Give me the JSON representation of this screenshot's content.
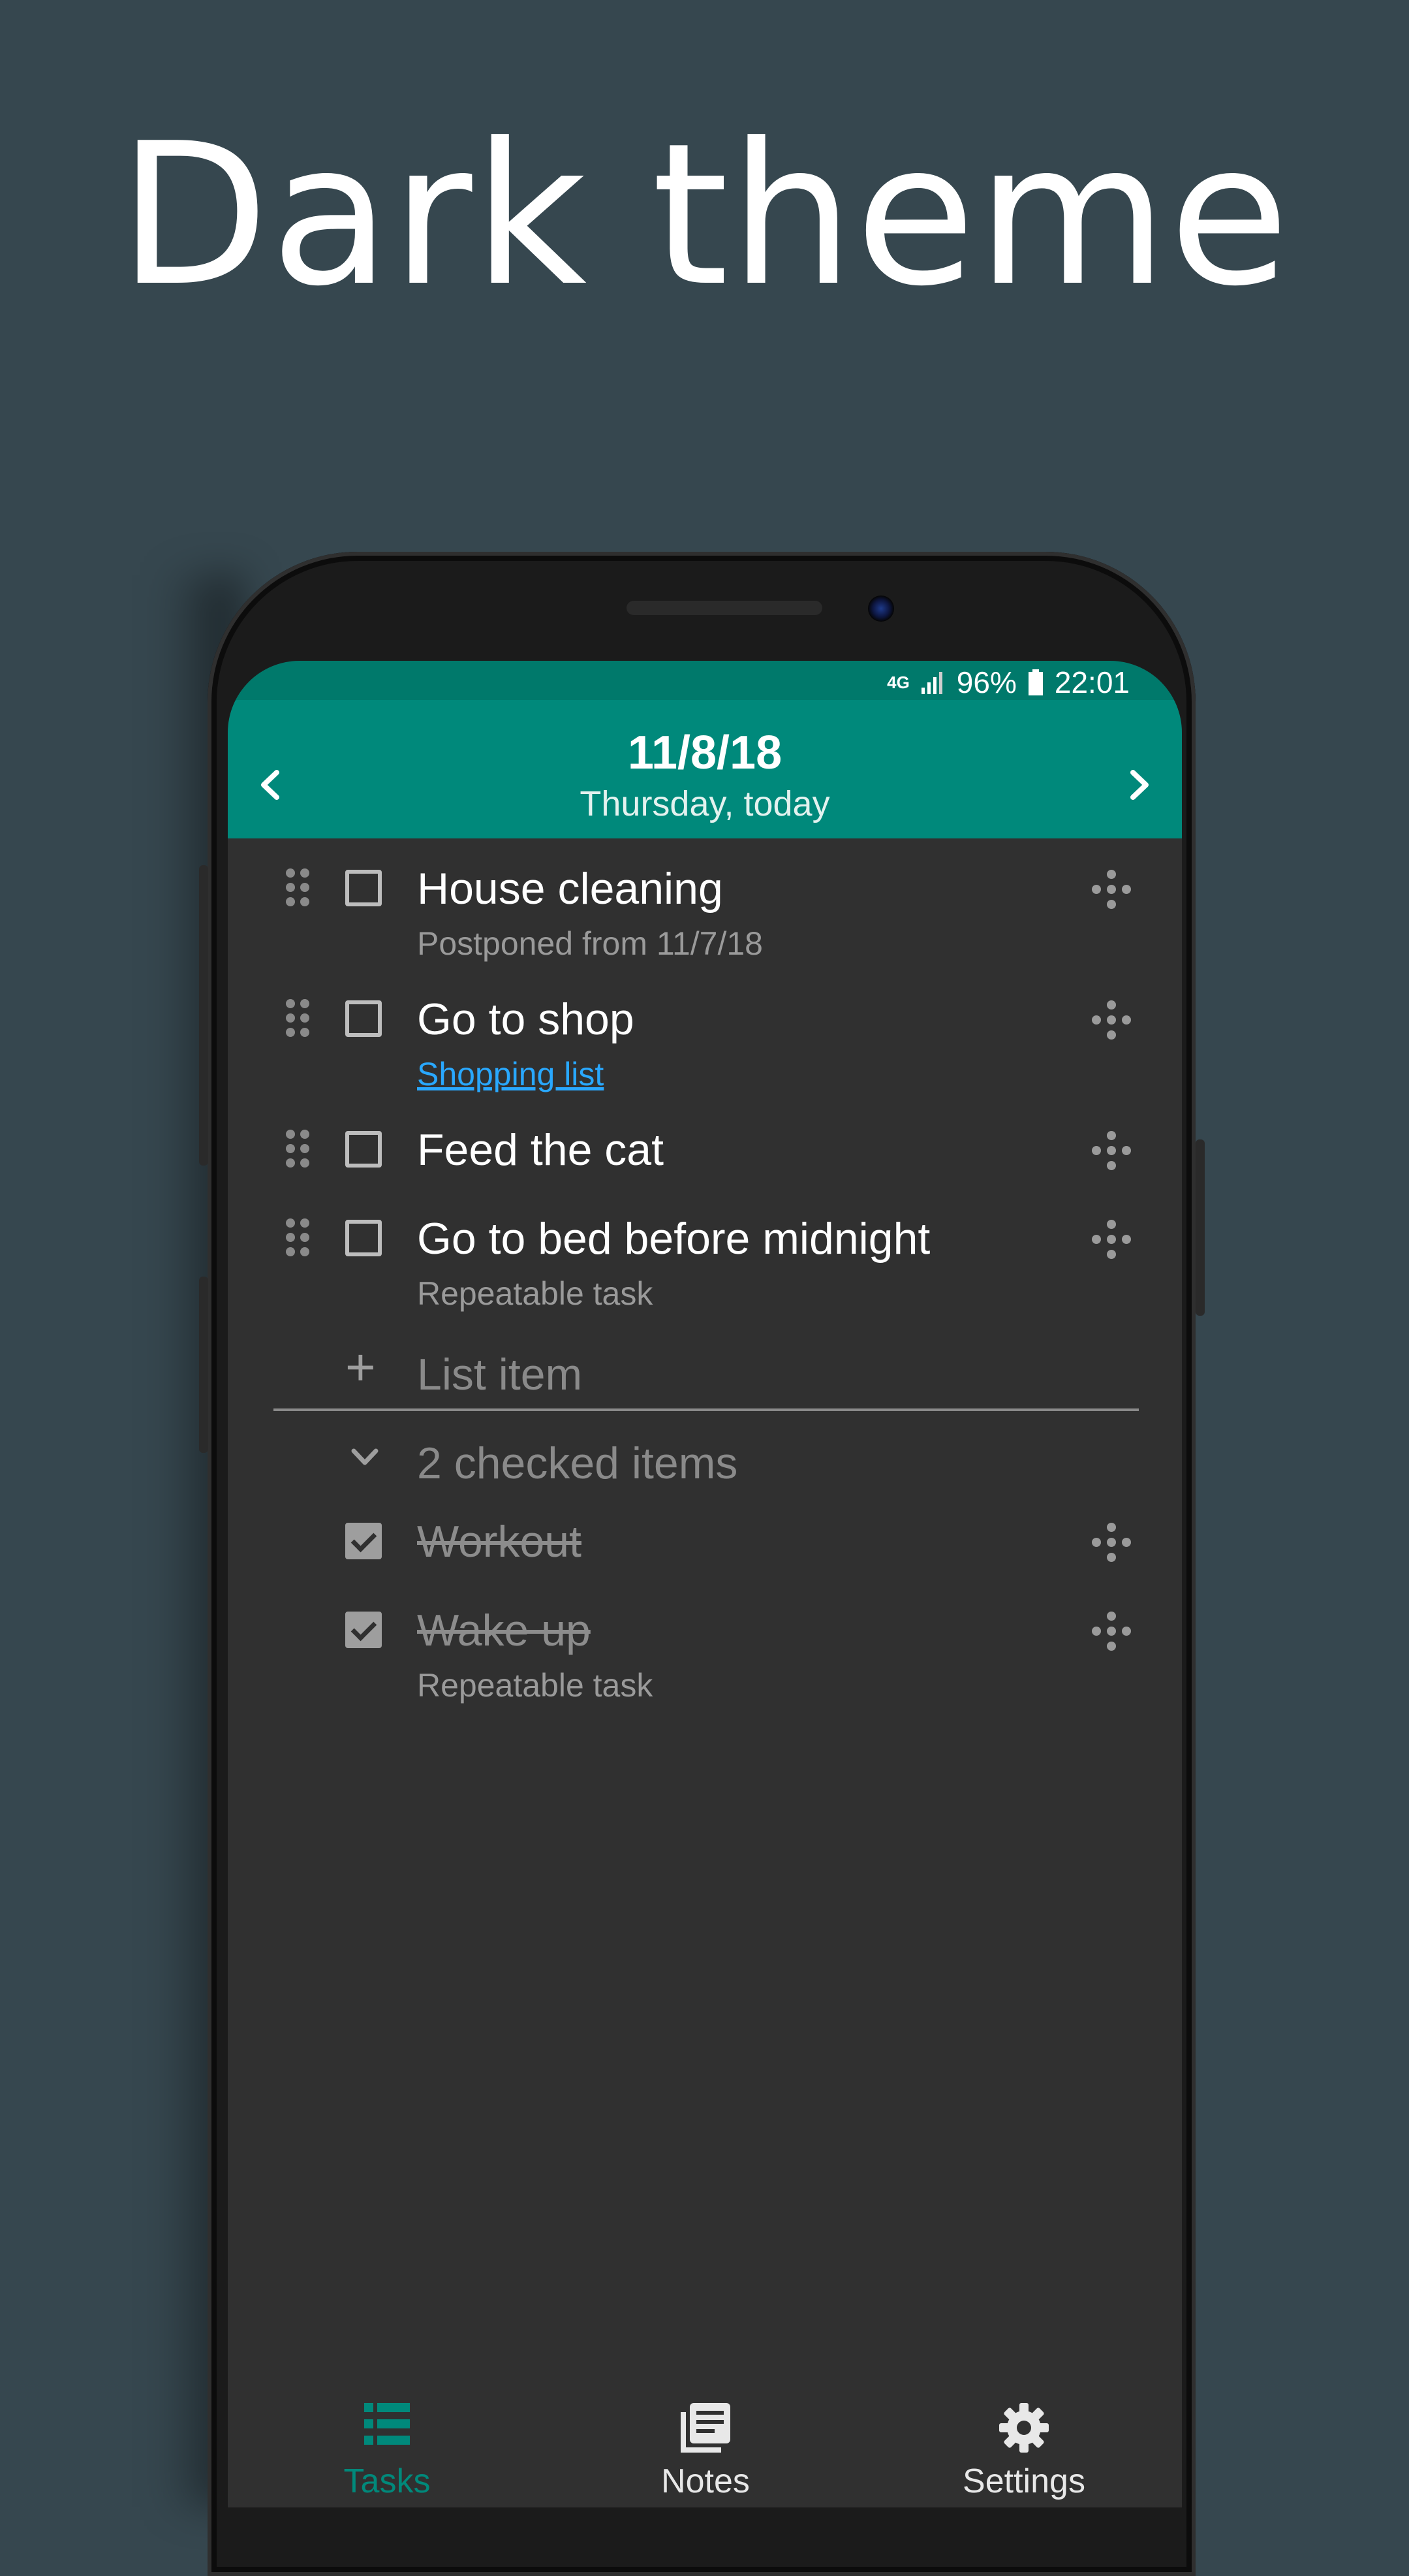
{
  "headline": "Dark theme",
  "status": {
    "network": "4G",
    "battery": "96%",
    "time": "22:01"
  },
  "appbar": {
    "date": "11/8/18",
    "day": "Thursday, today",
    "prev_icon": "chevron-left-icon",
    "next_icon": "chevron-right-icon"
  },
  "tasks": [
    {
      "title": "House cleaning",
      "subtitle": "Postponed from 11/7/18"
    },
    {
      "title": "Go to shop",
      "link": "Shopping list"
    },
    {
      "title": "Feed the cat"
    },
    {
      "title": "Go to bed before midnight",
      "subtitle": "Repeatable task"
    }
  ],
  "add_item_label": "List item",
  "checked_header": "2 checked items",
  "checked": [
    {
      "title": "Workout"
    },
    {
      "title": "Wake up",
      "subtitle": "Repeatable task"
    }
  ],
  "bottom_nav": [
    {
      "label": "Tasks",
      "icon": "list-icon",
      "active": true
    },
    {
      "label": "Notes",
      "icon": "notes-icon"
    },
    {
      "label": "Settings",
      "icon": "gear-icon"
    }
  ],
  "colors": {
    "accent": "#00897b",
    "status_bar": "#00796b",
    "background": "#36474f",
    "screen": "#303030",
    "link": "#29a8ff"
  }
}
